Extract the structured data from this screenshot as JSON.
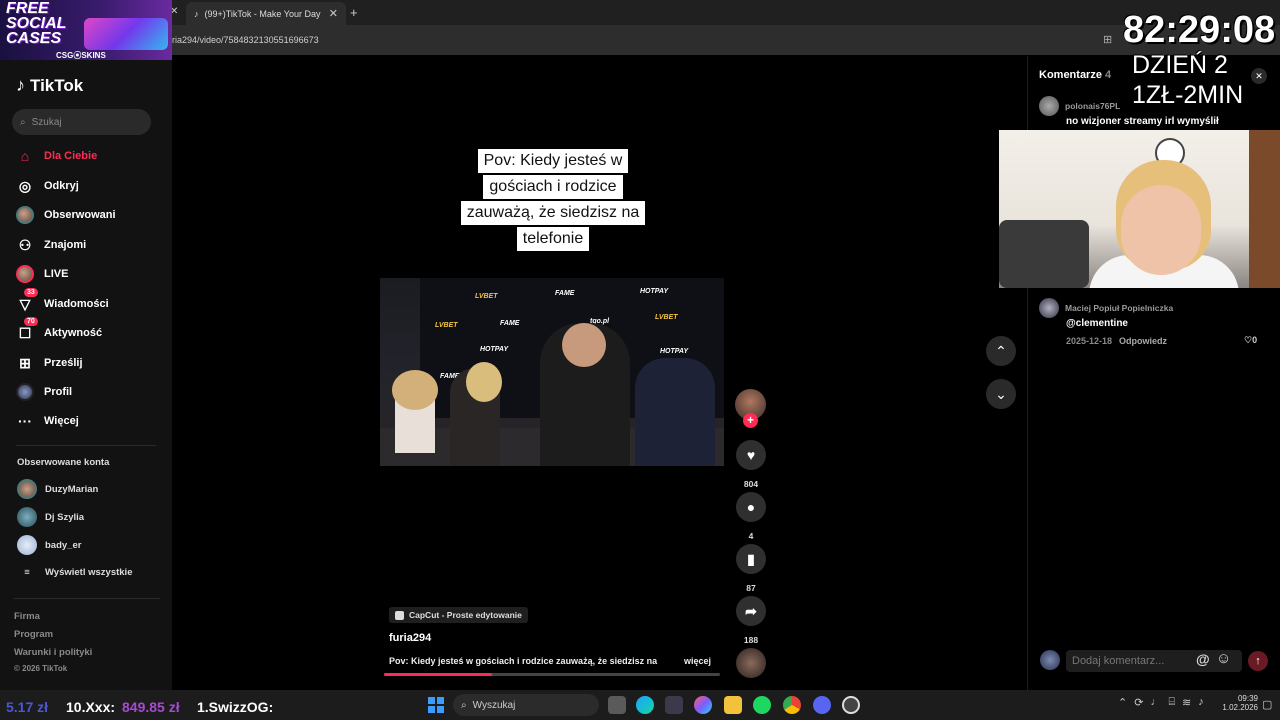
{
  "browser": {
    "tab_title": "(99+)TikTok - Make Your Day",
    "url": "ria294/video/7584832130551696673"
  },
  "promo": {
    "headline_line1": "FREE",
    "headline_line2": "SOCIAL",
    "headline_line3": "CASES",
    "brand": "CSG⦿SKINS"
  },
  "sidebar": {
    "logo": "TikTok",
    "search_placeholder": "Szukaj",
    "items": [
      {
        "label": "Dla Ciebie",
        "icon": "home-icon"
      },
      {
        "label": "Odkryj",
        "icon": "compass-icon"
      },
      {
        "label": "Obserwowani",
        "icon": "avatar-icon"
      },
      {
        "label": "Znajomi",
        "icon": "friends-icon"
      },
      {
        "label": "LIVE",
        "icon": "live-icon"
      },
      {
        "label": "Wiadomości",
        "icon": "messages-icon",
        "badge": "33"
      },
      {
        "label": "Aktywność",
        "icon": "activity-icon",
        "badge": "70"
      },
      {
        "label": "Prześlij",
        "icon": "upload-icon"
      },
      {
        "label": "Profil",
        "icon": "profile-icon"
      },
      {
        "label": "Więcej",
        "icon": "more-icon"
      }
    ],
    "followed_header": "Obserwowane konta",
    "followed": [
      {
        "name": "DuzyMarian"
      },
      {
        "name": "Dj Szylia"
      },
      {
        "name": "bady_er"
      }
    ],
    "show_all": "Wyświetl wszystkie",
    "footer": {
      "company": "Firma",
      "program": "Program",
      "terms": "Warunki i polityki",
      "copyright": "© 2026 TikTok"
    }
  },
  "video": {
    "caption_lines": [
      "Pov: Kiedy jesteś w",
      "gościach i rodzice",
      "zauważą, że siedzisz na",
      "telefonie"
    ],
    "capcut_label": "CapCut - Proste edytowanie",
    "username": "furia294",
    "description": "Pov: Kiedy jesteś w gościach i rodzice zauważą, że siedzisz na",
    "more_label": "więcej",
    "progress": 0.32,
    "banner_logos": [
      "LVBET",
      "FAME",
      "HOTPAY",
      "tgo.pl"
    ],
    "actions": {
      "likes": "804",
      "comments": "4",
      "saves": "87",
      "shares": "188"
    }
  },
  "comments": {
    "title": "Komentarze",
    "count": "4",
    "items": [
      {
        "user": "polonais76PL",
        "text": "no wizjoner streamy irl wymyślił"
      },
      {
        "user": "Maciej Popiuł Popielniczka",
        "text": "@clementine",
        "date": "2025-12-18",
        "reply": "Odpowiedz",
        "likes": "0"
      }
    ],
    "input_placeholder": "Dodaj komentarz...",
    "at_symbol": "@"
  },
  "overlay": {
    "timer": "82:29:08",
    "day": "DZIEŃ 2",
    "rate": "1ZŁ-2MIN"
  },
  "taskbar": {
    "donation1": "5.17 zł",
    "donation2_name": "10.Xxx:",
    "donation2_amount": "849.85 zł",
    "donation3_name": "1.SwizzOG:",
    "search_label": "Wyszukaj",
    "time": "09:39",
    "date": "1.02.2026"
  },
  "colors": {
    "accent": "#fe2c55",
    "background": "#000000",
    "sidebar": "#121212"
  }
}
